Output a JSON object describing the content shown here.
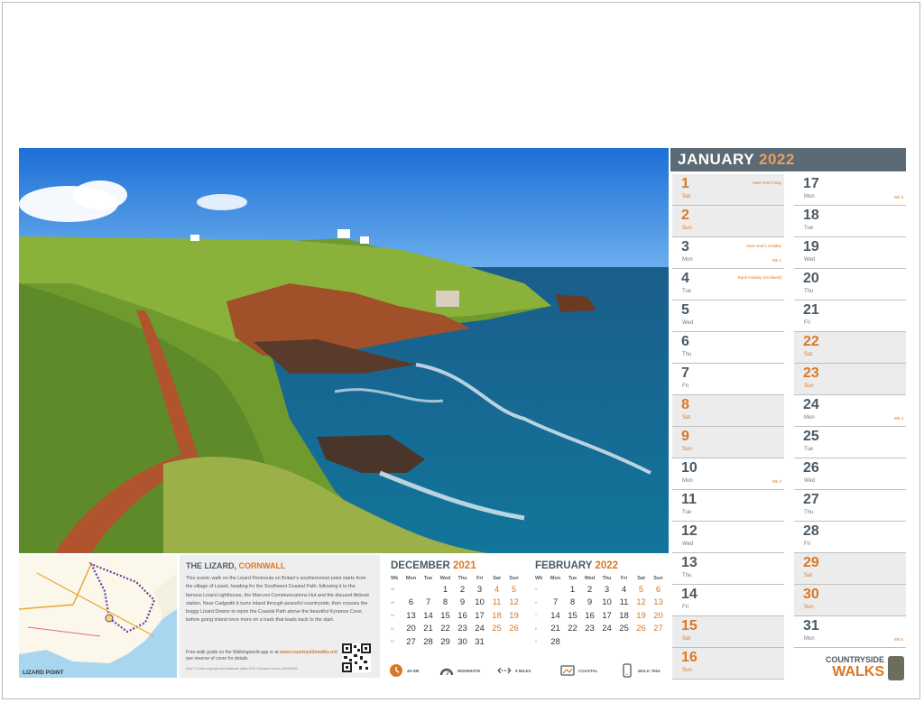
{
  "month": {
    "name": "JANUARY",
    "year": "2022"
  },
  "days_col1": [
    {
      "num": "1",
      "dn": "Sat",
      "we": true,
      "ev": "New Year's Day",
      "wk": ""
    },
    {
      "num": "2",
      "dn": "Sun",
      "we": true,
      "ev": "",
      "wk": ""
    },
    {
      "num": "3",
      "dn": "Mon",
      "we": false,
      "ev": "New Year's Holiday",
      "wk": "Wk 1"
    },
    {
      "num": "4",
      "dn": "Tue",
      "we": false,
      "ev": "Bank Holiday (Scotland)",
      "wk": ""
    },
    {
      "num": "5",
      "dn": "Wed",
      "we": false,
      "ev": "",
      "wk": ""
    },
    {
      "num": "6",
      "dn": "Thu",
      "we": false,
      "ev": "",
      "wk": ""
    },
    {
      "num": "7",
      "dn": "Fri",
      "we": false,
      "ev": "",
      "wk": ""
    },
    {
      "num": "8",
      "dn": "Sat",
      "we": true,
      "ev": "",
      "wk": ""
    },
    {
      "num": "9",
      "dn": "Sun",
      "we": true,
      "ev": "",
      "wk": ""
    },
    {
      "num": "10",
      "dn": "Mon",
      "we": false,
      "ev": "",
      "wk": "Wk 2"
    },
    {
      "num": "11",
      "dn": "Tue",
      "we": false,
      "ev": "",
      "wk": ""
    },
    {
      "num": "12",
      "dn": "Wed",
      "we": false,
      "ev": "",
      "wk": ""
    },
    {
      "num": "13",
      "dn": "Thu",
      "we": false,
      "ev": "",
      "wk": ""
    },
    {
      "num": "14",
      "dn": "Fri",
      "we": false,
      "ev": "",
      "wk": ""
    },
    {
      "num": "15",
      "dn": "Sat",
      "we": true,
      "ev": "",
      "wk": ""
    },
    {
      "num": "16",
      "dn": "Sun",
      "we": true,
      "ev": "",
      "wk": ""
    }
  ],
  "days_col2": [
    {
      "num": "17",
      "dn": "Mon",
      "we": false,
      "ev": "",
      "wk": "Wk 3"
    },
    {
      "num": "18",
      "dn": "Tue",
      "we": false,
      "ev": "",
      "wk": ""
    },
    {
      "num": "19",
      "dn": "Wed",
      "we": false,
      "ev": "",
      "wk": ""
    },
    {
      "num": "20",
      "dn": "Thu",
      "we": false,
      "ev": "",
      "wk": ""
    },
    {
      "num": "21",
      "dn": "Fri",
      "we": false,
      "ev": "",
      "wk": ""
    },
    {
      "num": "22",
      "dn": "Sat",
      "we": true,
      "ev": "",
      "wk": ""
    },
    {
      "num": "23",
      "dn": "Sun",
      "we": true,
      "ev": "",
      "wk": ""
    },
    {
      "num": "24",
      "dn": "Mon",
      "we": false,
      "ev": "",
      "wk": "Wk 4"
    },
    {
      "num": "25",
      "dn": "Tue",
      "we": false,
      "ev": "",
      "wk": ""
    },
    {
      "num": "26",
      "dn": "Wed",
      "we": false,
      "ev": "",
      "wk": ""
    },
    {
      "num": "27",
      "dn": "Thu",
      "we": false,
      "ev": "",
      "wk": ""
    },
    {
      "num": "28",
      "dn": "Fri",
      "we": false,
      "ev": "",
      "wk": ""
    },
    {
      "num": "29",
      "dn": "Sat",
      "we": true,
      "ev": "",
      "wk": ""
    },
    {
      "num": "30",
      "dn": "Sun",
      "we": true,
      "ev": "",
      "wk": ""
    },
    {
      "num": "31",
      "dn": "Mon",
      "we": false,
      "ev": "",
      "wk": "Wk 5"
    }
  ],
  "brand": {
    "line1": "COUNTRYSIDE",
    "line2": "WALKS"
  },
  "walk": {
    "title": "THE LIZARD,",
    "county": "CORNWALL",
    "body": "This scenic walk on the Lizard Peninsula on Britain's southernmost point starts from the village of Lizard, heading for the Southwest Coastal Path, following it to the famous Lizard Lighthouse, the Marconi Communications Hut and the disused lifeboat station. Near Cadgwith it turns inland through peaceful countryside, then crosses the boggy Lizard Downs to rejoin the Coastal Path above the beautiful Kynance Cove, before going inland once more on a track that leads back to the start.",
    "guide_prefix": "Free walk guide on the Walkingworld app or at",
    "guide_url": "www.countrysidewalks.net",
    "guide_suffix": "see reverse of cover for details.",
    "copyright": "Map © Crown copyright and database rights 2020 Ordnance Survey 100054820"
  },
  "map": {
    "label": "LIZARD POINT"
  },
  "dec": {
    "name": "DECEMBER",
    "year": "2021",
    "headers": [
      "Wk",
      "Mon",
      "Tue",
      "Wed",
      "Thu",
      "Fri",
      "Sat",
      "Sun"
    ],
    "rows": [
      [
        "48",
        "",
        "",
        "1",
        "2",
        "3",
        "4",
        "5"
      ],
      [
        "49",
        "6",
        "7",
        "8",
        "9",
        "10",
        "11",
        "12"
      ],
      [
        "50",
        "13",
        "14",
        "15",
        "16",
        "17",
        "18",
        "19"
      ],
      [
        "51",
        "20",
        "21",
        "22",
        "23",
        "24",
        "25",
        "26"
      ],
      [
        "52",
        "27",
        "28",
        "29",
        "30",
        "31",
        "",
        ""
      ]
    ]
  },
  "feb": {
    "name": "FEBRUARY",
    "year": "2022",
    "headers": [
      "Wk",
      "Mon",
      "Tue",
      "Wed",
      "Thu",
      "Fri",
      "Sat",
      "Sun"
    ],
    "rows": [
      [
        "5",
        "",
        "1",
        "2",
        "3",
        "4",
        "5",
        "6"
      ],
      [
        "6",
        "7",
        "8",
        "9",
        "10",
        "11",
        "12",
        "13"
      ],
      [
        "7",
        "14",
        "15",
        "16",
        "17",
        "18",
        "19",
        "20"
      ],
      [
        "8",
        "21",
        "22",
        "23",
        "24",
        "25",
        "26",
        "27"
      ],
      [
        "9",
        "28",
        "",
        "",
        "",
        "",
        "",
        ""
      ]
    ]
  },
  "stats": [
    {
      "icon": "clock-icon",
      "label": "4H 5M"
    },
    {
      "icon": "gauge-icon",
      "label": "MODERATE"
    },
    {
      "icon": "distance-icon",
      "label": "9 MILES"
    },
    {
      "icon": "map-icon",
      "label": "COASTAL"
    },
    {
      "icon": "phone-icon",
      "label": "WALK 7554"
    }
  ]
}
